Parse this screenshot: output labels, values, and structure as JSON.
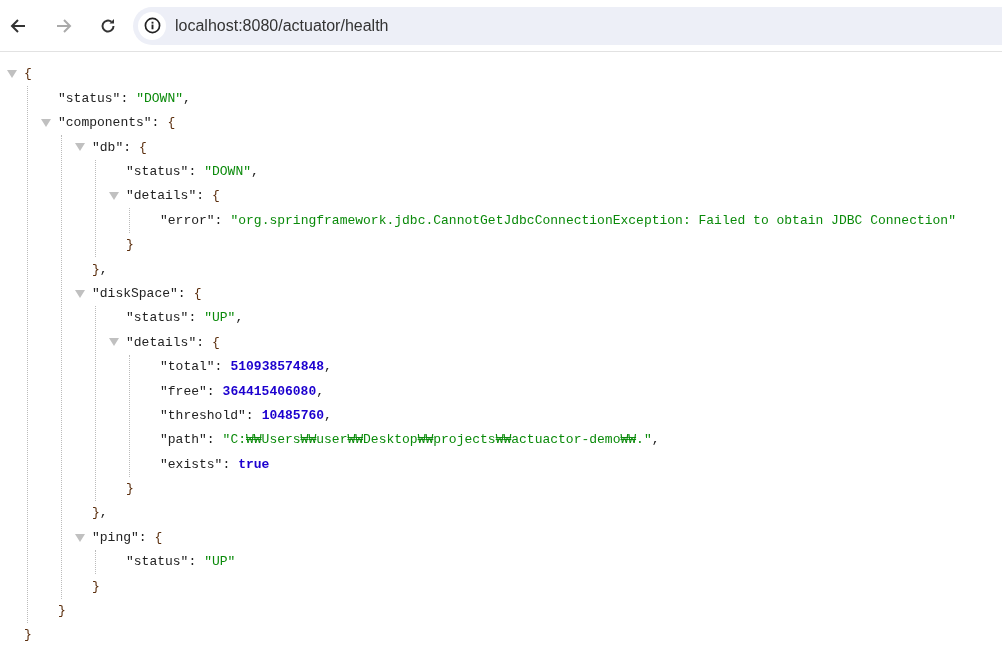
{
  "toolbar": {
    "back": {
      "disabled": false
    },
    "forward": {
      "disabled": true
    },
    "url": "localhost:8080/actuator/health"
  },
  "document": {
    "open": "{",
    "close": "}",
    "expanded": true,
    "children": [
      {
        "kind": "string",
        "key": "\"status\":",
        "value": "\"DOWN\"",
        "after": ","
      },
      {
        "key": "\"components\":",
        "open": "{",
        "close": "}",
        "expanded": true,
        "children": [
          {
            "key": "\"db\":",
            "open": "{",
            "close": "}",
            "after": ",",
            "expanded": true,
            "children": [
              {
                "kind": "string",
                "key": "\"status\":",
                "value": "\"DOWN\"",
                "after": ","
              },
              {
                "key": "\"details\":",
                "open": "{",
                "close": "}",
                "expanded": true,
                "children": [
                  {
                    "kind": "string",
                    "key": "\"error\":",
                    "value": "\"org.springframework.jdbc.CannotGetJdbcConnectionException: Failed to obtain JDBC Connection\""
                  }
                ]
              }
            ]
          },
          {
            "key": "\"diskSpace\":",
            "open": "{",
            "close": "}",
            "after": ",",
            "expanded": true,
            "children": [
              {
                "kind": "string",
                "key": "\"status\":",
                "value": "\"UP\"",
                "after": ","
              },
              {
                "key": "\"details\":",
                "open": "{",
                "close": "}",
                "expanded": true,
                "children": [
                  {
                    "kind": "number",
                    "key": "\"total\":",
                    "value": "510938574848",
                    "after": ","
                  },
                  {
                    "kind": "number",
                    "key": "\"free\":",
                    "value": "364415406080",
                    "after": ","
                  },
                  {
                    "kind": "number",
                    "key": "\"threshold\":",
                    "value": "10485760",
                    "after": ","
                  },
                  {
                    "kind": "string",
                    "key": "\"path\":",
                    "value": "\"C:₩₩Users₩₩user₩₩Desktop₩₩projects₩₩actuactor-demo₩₩.\"",
                    "after": ","
                  },
                  {
                    "kind": "boolean",
                    "key": "\"exists\":",
                    "value": "true"
                  }
                ]
              }
            ]
          },
          {
            "key": "\"ping\":",
            "open": "{",
            "close": "}",
            "expanded": true,
            "children": [
              {
                "kind": "string",
                "key": "\"status\":",
                "value": "\"UP\""
              }
            ]
          }
        ]
      }
    ]
  }
}
